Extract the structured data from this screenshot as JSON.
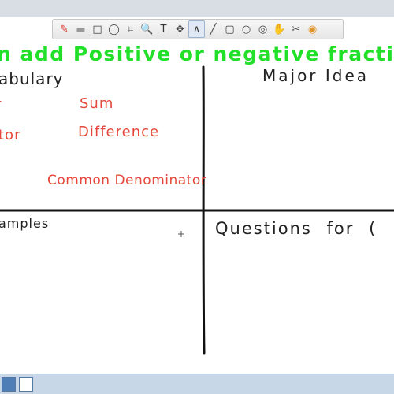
{
  "toolbar": {
    "tools": [
      {
        "name": "pen-tool",
        "glyph": "✎",
        "color": "#d9342b",
        "active": false
      },
      {
        "name": "highlighter-tool",
        "glyph": "▬",
        "color": "#999999",
        "active": false
      },
      {
        "name": "rectangle-select-tool",
        "glyph": "□",
        "color": "#444444",
        "active": false
      },
      {
        "name": "lasso-tool",
        "glyph": "◯",
        "color": "#444444",
        "active": false
      },
      {
        "name": "crop-tool",
        "glyph": "⌗",
        "color": "#444444",
        "active": false
      },
      {
        "name": "zoom-tool",
        "glyph": "🔍",
        "color": "#444444",
        "active": false
      },
      {
        "name": "text-tool",
        "glyph": "T",
        "color": "#333333",
        "active": false
      },
      {
        "name": "move-tool",
        "glyph": "✥",
        "color": "#444444",
        "active": false
      },
      {
        "name": "freehand-line-tool",
        "glyph": "∧",
        "color": "#333333",
        "active": true
      },
      {
        "name": "line-tool",
        "glyph": "╱",
        "color": "#444444",
        "active": false
      },
      {
        "name": "square-shape-tool",
        "glyph": "▢",
        "color": "#444444",
        "active": false
      },
      {
        "name": "circle-shape-tool",
        "glyph": "○",
        "color": "#444444",
        "active": false
      },
      {
        "name": "dot-tool",
        "glyph": "◎",
        "color": "#444444",
        "active": false
      },
      {
        "name": "hand-tool",
        "glyph": "✋",
        "color": "#444444",
        "active": false
      },
      {
        "name": "scissors-tool",
        "glyph": "✂",
        "color": "#444444",
        "active": false
      },
      {
        "name": "color-picker-tool",
        "glyph": "◉",
        "color": "#e0952a",
        "active": false
      }
    ]
  },
  "canvas": {
    "title": "n add Positive or negative fracti",
    "top_left_header": "abulary",
    "top_right_header": "Major Idea",
    "bottom_left_header": "amples",
    "bottom_right_header": "Questions for (",
    "vocab": {
      "sum": "Sum",
      "tor": "tor",
      "difference": "Difference",
      "common_denominator": "Common Denominator",
      "fragment": "r"
    },
    "colors": {
      "title": "#22e02a",
      "vocab": "#e5483b",
      "ink": "#1a1a1a"
    }
  },
  "bottombar": {
    "buttons": [
      {
        "name": "page-thumbnail-1",
        "glyph": "",
        "selected": true
      },
      {
        "name": "page-thumbnail-2",
        "glyph": "",
        "selected": false
      }
    ]
  }
}
